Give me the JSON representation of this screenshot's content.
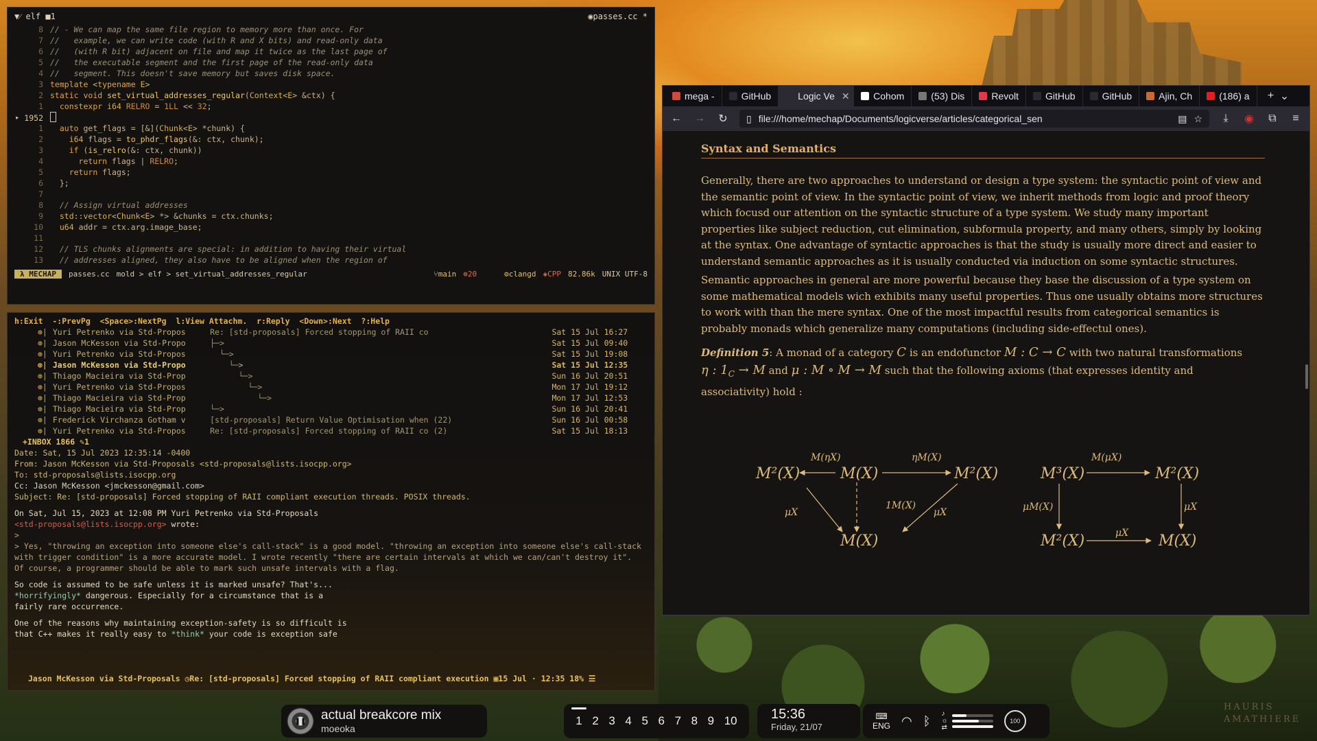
{
  "colors": {
    "accent": "#e6a23c",
    "mode_badge": "#c7b25b",
    "browser_bg": "#1c1b22",
    "doc_text": "#dcbb7c",
    "doc_heading": "#e2b068"
  },
  "editor": {
    "title_left": "elf",
    "title_num": "1",
    "filename_tab": "passes.cc",
    "modified_marker": "*",
    "lines": [
      {
        "n": "8",
        "text": "// - We can map the same file region to memory more than once. For"
      },
      {
        "n": "7",
        "text": "//   example, we can write code (with R and X bits) and read-only data"
      },
      {
        "n": "6",
        "text": "//   (with R bit) adjacent on file and map it twice as the last page of"
      },
      {
        "n": "5",
        "text": "//   the executable segment and the first page of the read-only data"
      },
      {
        "n": "4",
        "text": "//   segment. This doesn't save memory but saves disk space."
      },
      {
        "n": "3",
        "text": "template <typename E>"
      },
      {
        "n": "2",
        "text": "static void set_virtual_addresses_regular(Context<E> &ctx) {"
      },
      {
        "n": "1",
        "text": "  constexpr i64 RELRO = 1LL << 32;"
      },
      {
        "n": "1952",
        "text": ""
      },
      {
        "n": "1",
        "text": "  auto get_flags = [&](Chunk<E> *chunk) {"
      },
      {
        "n": "2",
        "text": "    i64 flags = to_phdr_flags(&: ctx, chunk);"
      },
      {
        "n": "3",
        "text": "    if (is_relro(&: ctx, chunk))"
      },
      {
        "n": "4",
        "text": "      return flags | RELRO;"
      },
      {
        "n": "5",
        "text": "    return flags;"
      },
      {
        "n": "6",
        "text": "  };"
      },
      {
        "n": "7",
        "text": ""
      },
      {
        "n": "8",
        "text": "  // Assign virtual addresses"
      },
      {
        "n": "9",
        "text": "  std::vector<Chunk<E> *> &chunks = ctx.chunks;"
      },
      {
        "n": "10",
        "text": "  u64 addr = ctx.arg.image_base;"
      },
      {
        "n": "11",
        "text": ""
      },
      {
        "n": "12",
        "text": "  // TLS chunks alignments are special: in addition to having their virtual"
      },
      {
        "n": "13",
        "text": "  // addresses aligned, they also have to be aligned when the region of"
      }
    ],
    "status": {
      "mode": "λ MECHAP",
      "file": "passes.cc",
      "crumbs": "mold > elf > set_virtual_addresses_regular",
      "branch": "main",
      "errors": "20",
      "lsp": "clangd",
      "lang": "CPP",
      "size": "82.86k",
      "encoding": "UNIX UTF-8"
    }
  },
  "mail": {
    "help": "h:Exit  -:PrevPg  <Space>:NextPg  l:View Attachm.  r:Reply  <Down>:Next  ?:Help",
    "rows": [
      {
        "from": "Yuri Petrenko via Std-Propos",
        "subject": "Re: [std-proposals] Forced stopping of RAII co",
        "date": "Sat 15 Jul 16:27",
        "bold": false
      },
      {
        "from": "Jason McKesson via Std-Propo",
        "subject": "├─>",
        "date": "Sat 15 Jul 09:40",
        "bold": false
      },
      {
        "from": "Yuri Petrenko via Std-Propos",
        "subject": "  └─>",
        "date": "Sat 15 Jul 19:08",
        "bold": false
      },
      {
        "from": "Jason McKesson via Std-Propo",
        "subject": "    └─>",
        "date": "Sat 15 Jul 12:35",
        "bold": true
      },
      {
        "from": "Thiago Macieira via Std-Prop",
        "subject": "      └─>",
        "date": "Sun 16 Jul 20:51",
        "bold": false
      },
      {
        "from": "Yuri Petrenko via Std-Propos",
        "subject": "        └─>",
        "date": "Mon 17 Jul 19:12",
        "bold": false
      },
      {
        "from": "Thiago Macieira via Std-Prop",
        "subject": "          └─>",
        "date": "Mon 17 Jul 12:53",
        "bold": false
      },
      {
        "from": "Thiago Macieira via Std-Prop",
        "subject": "└─>",
        "date": "Sun 16 Jul 20:41",
        "bold": false
      },
      {
        "from": "Frederick Virchanza Gotham v",
        "subject": "[std-proposals] Return Value Optimisation when (22)",
        "date": "Sun 16 Jul 00:58",
        "bold": false
      },
      {
        "from": "Yuri Petrenko via Std-Propos",
        "subject": "Re: [std-proposals] Forced stopping of RAII co (2)",
        "date": "Sat 15 Jul 18:13",
        "bold": false
      }
    ],
    "inbox": "+INBOX   1866 ✎1",
    "headers": {
      "date": "Date: Sat, 15 Jul 2023 12:35:14 -0400",
      "from": "From: Jason McKesson via Std-Proposals <std-proposals@lists.isocpp.org>",
      "to": "To: std-proposals@lists.isocpp.org",
      "cc": "Cc: Jason McKesson <jmckesson@gmail.com>",
      "subject": "Subject: Re: [std-proposals] Forced stopping of RAII compliant execution threads. POSIX threads."
    },
    "body": {
      "l1": "On Sat, Jul 15, 2023 at 12:08 PM Yuri Petrenko via Std-Proposals",
      "l2_link": "<std-proposals@lists.isocpp.org>",
      "l2_rest": " wrote:",
      "l3": ">",
      "q1": "> Yes, \"throwing an exception into someone else's call-stack\" is a good model. \"throwing an exception into someone else's call-stack",
      "q2": "with trigger condition\" is a more accurate model. I wrote recently \"there are certain intervals at which we can/can't destroy it\".",
      "q3": "Of course, a programmer should be able to mark such unsafe intervals with a flag.",
      "p1": "So code is assumed to be safe unless it is marked unsafe? That's...",
      "p2_emph": "*horrifyingly*",
      "p2_rest": " dangerous. Especially for a circumstance that is a",
      "p3": "fairly rare occurrence.",
      "p4": "One of the reasons why maintaining exception-safety is so difficult is",
      "p5_pre": "that C++ makes it really easy to ",
      "p5_emph": "*think*",
      "p5_post": " your code is exception safe"
    },
    "footer": "Jason McKesson via Std-Proposals ◷Re: [std-proposals] Forced stopping of RAII compliant execution ▦15 Jul · 12:35 18% ☰"
  },
  "browser": {
    "tabs": [
      {
        "label": "mega -",
        "color": "#d04a3a",
        "active": false
      },
      {
        "label": "GitHub",
        "color": "#2b2a33",
        "active": false
      },
      {
        "label": "Logic Ve",
        "color": "#2b2a33",
        "active": true
      },
      {
        "label": "Cohom",
        "color": "#ffffff",
        "active": false
      },
      {
        "label": "(53) Dis",
        "color": "#777777",
        "active": false
      },
      {
        "label": "Revolt",
        "color": "#e03a4a",
        "active": false
      },
      {
        "label": "GitHub",
        "color": "#2b2a33",
        "active": false
      },
      {
        "label": "GitHub",
        "color": "#2b2a33",
        "active": false
      },
      {
        "label": "Ajin, Ch",
        "color": "#c96a30",
        "active": false
      },
      {
        "label": "(186) a",
        "color": "#e02020",
        "active": false
      }
    ],
    "url": "file:///home/mechap/Documents/logicverse/articles/categorical_sen",
    "section_title": "Syntax and Semantics",
    "para1": "Generally, there are two approaches to understand or design a type system: the syntactic point of view and the semantic point of view. In the syntactic point of view, we inherit methods from logic and proof theory which focusd our attention on the syntactic structure of a type system. We study many important properties like subject reduction, cut elimination, subformula property, and many others, simply by looking at the syntax. One advantage of syntactic approaches is that the study is usually more direct and easier to understand semantic approaches as it is usually conducted via induction on some syntactic structures.",
    "para2": "Semantic approaches in general are more powerful because they base the discussion of a type system on some mathematical models wich exhibits many useful properties. Thus one usually obtains more structures to work with than the mere syntax. One of the most impactful results from categorical semantics is probably monads which generalize many computations (including side-effectul ones).",
    "def_label": "Definition 5",
    "def_l1a": ": A monad of a category ",
    "def_C": "C",
    "def_l1b": " is an endofunctor ",
    "def_func": "M : C → C",
    "def_l1c": " with two natural transformations",
    "def_eta": "η : 1",
    "def_eta_sub": "C",
    "def_eta_rest": " → M",
    "def_and": " and ",
    "def_mu": "μ : M ∘ M → M",
    "def_l2c": " such that the following axioms (that expresses identity and",
    "def_l3": "associativity) hold :",
    "diagram": {
      "left_tl": "M²(X)",
      "left_tm": "M(X)",
      "left_tr": "M²(X)",
      "left_b": "M(X)",
      "arr_l": "M(ηX)",
      "arr_r": "ηM(X)",
      "id": "1M(X)",
      "mu1": "μX",
      "mu2": "μX",
      "right_tl": "M³(X)",
      "right_tr": "M²(X)",
      "right_bl": "M²(X)",
      "right_br": "M(X)",
      "r_top": "M(μX)",
      "r_left": "μM(X)",
      "r_right": "μX",
      "r_bot": "μX"
    }
  },
  "taskbar": {
    "music_title": "actual breakcore mix",
    "music_artist": "moeoka",
    "workspaces": [
      "1",
      "2",
      "3",
      "4",
      "5",
      "6",
      "7",
      "8",
      "9",
      "10"
    ],
    "active_ws": "1",
    "time": "15:36",
    "date": "Friday, 21/07",
    "lang": "ENG",
    "battery": "100",
    "volume_level": 0.35,
    "brightness_level": 0.65
  },
  "wallpaper_text": "HAURIS AMATHIERE"
}
